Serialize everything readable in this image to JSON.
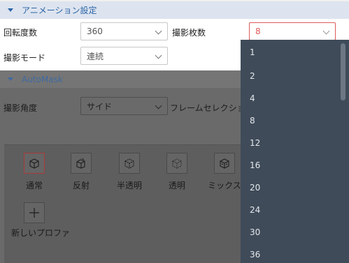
{
  "animation": {
    "section_title": "アニメーション設定",
    "rotation_label": "回転度数",
    "rotation_value": "360",
    "shot_count_label": "撮影枚数",
    "shot_count_value": "8",
    "mode_label": "撮影モード",
    "mode_value": "連続"
  },
  "automask": {
    "section_title": "AutoMask",
    "angle_label": "撮影角度",
    "angle_value": "サイド",
    "frame_selection_label": "フレームセレクション",
    "modes": [
      {
        "label": "通常",
        "icon": "cube-icon"
      },
      {
        "label": "反射",
        "icon": "reflect-cube-icon"
      },
      {
        "label": "半透明",
        "icon": "semi-transparent-cube-icon"
      },
      {
        "label": "透明",
        "icon": "transparent-cube-icon"
      },
      {
        "label": "ミックス",
        "icon": "mixed-cube-icon"
      }
    ],
    "new_profile_label": "新しいプロファ"
  },
  "dropdown": {
    "options": [
      "1",
      "2",
      "4",
      "8",
      "12",
      "16",
      "20",
      "24",
      "30",
      "36"
    ]
  },
  "colors": {
    "accent": "#2a63a6",
    "error_red": "#e05a5a",
    "dropdown_bg": "#3f4b59"
  }
}
